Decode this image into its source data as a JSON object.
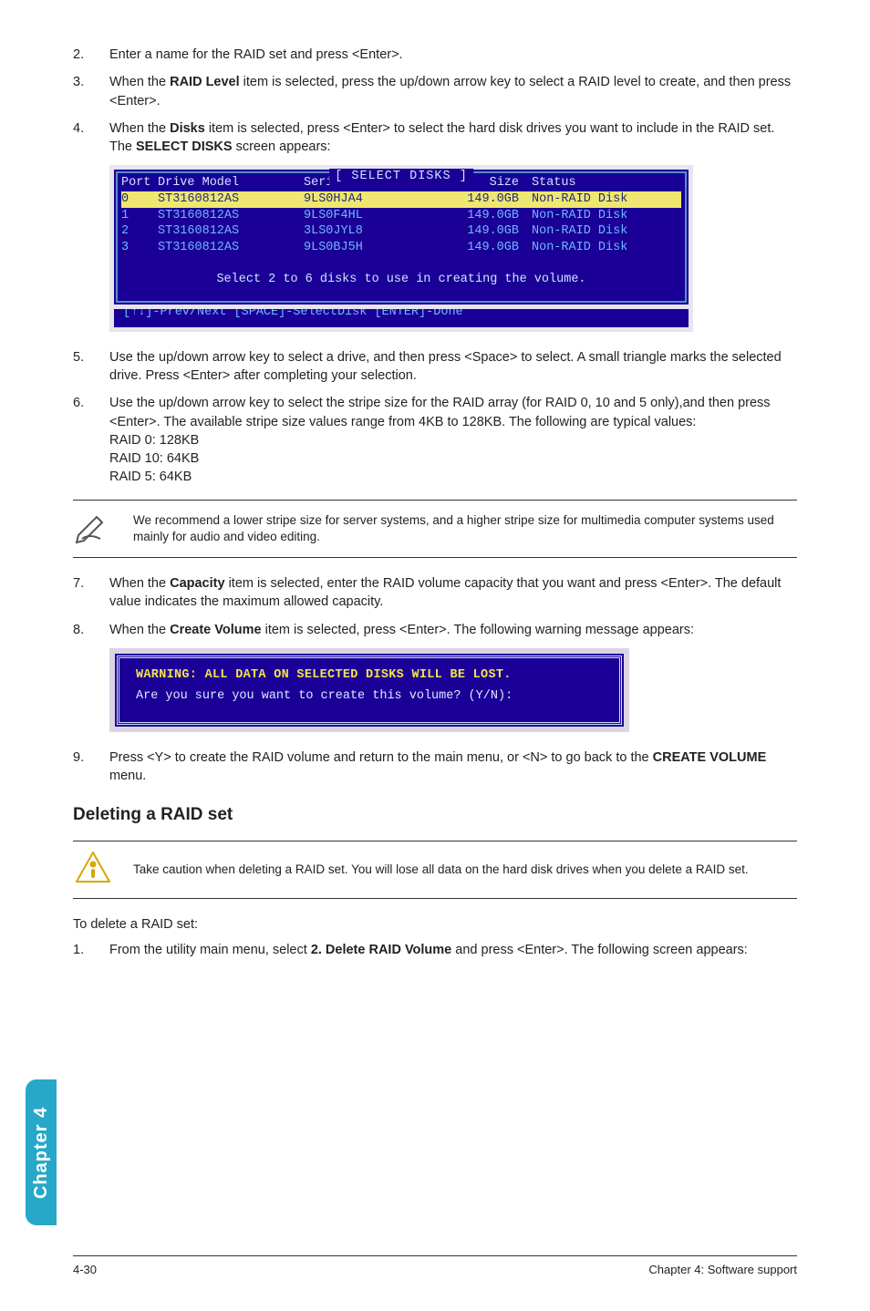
{
  "steps_a": {
    "s2": {
      "num": "2.",
      "text": "Enter a name for the RAID set and press <Enter>."
    },
    "s3": {
      "num": "3.",
      "text_a": "When the ",
      "bold": "RAID Level",
      "text_b": " item is selected, press the up/down arrow key to select a RAID level to create, and then press <Enter>."
    },
    "s4": {
      "num": "4.",
      "text_a": "When the ",
      "bold": "Disks",
      "text_b": " item is selected, press <Enter> to select the hard disk drives you want to include in the RAID set. The ",
      "bold2": "SELECT DISKS",
      "text_c": " screen appears:"
    }
  },
  "select_disks": {
    "title": "[ SELECT DISKS ]",
    "header": {
      "port": "Port",
      "drive": "Drive Model",
      "serial": "Serial #",
      "size": "Size",
      "status": "Status"
    },
    "rows": [
      {
        "port": "0",
        "drive": "ST3160812AS",
        "serial": "9LS0HJA4",
        "size": "149.0GB",
        "status": "Non-RAID Disk",
        "sel": true
      },
      {
        "port": "1",
        "drive": "ST3160812AS",
        "serial": "9LS0F4HL",
        "size": "149.0GB",
        "status": "Non-RAID Disk",
        "sel": false
      },
      {
        "port": "2",
        "drive": "ST3160812AS",
        "serial": "3LS0JYL8",
        "size": "149.0GB",
        "status": "Non-RAID Disk",
        "sel": false
      },
      {
        "port": "3",
        "drive": "ST3160812AS",
        "serial": "9LS0BJ5H",
        "size": "149.0GB",
        "status": "Non-RAID Disk",
        "sel": false
      }
    ],
    "footer": "Select 2 to 6 disks to use in creating the volume.",
    "legend": "[↑↓]-Prev/Next [SPACE]-SelectDisk [ENTER]-Done"
  },
  "steps_b": {
    "s5": {
      "num": "5.",
      "text": "Use the up/down arrow key to select a drive, and then press <Space> to select. A small triangle marks the selected drive. Press <Enter> after completing your selection."
    },
    "s6": {
      "num": "6.",
      "text": "Use the up/down arrow key to select the stripe size for the RAID array (for RAID 0, 10 and 5 only),and  then press <Enter>. The available stripe size values range from 4KB to 128KB. The following are typical values:",
      "l1": "RAID 0: 128KB",
      "l2": "RAID 10: 64KB",
      "l3": "RAID 5: 64KB"
    }
  },
  "note1": "We recommend a lower stripe size for server systems, and a higher stripe size for multimedia computer systems used mainly for audio and video editing.",
  "steps_c": {
    "s7": {
      "num": "7.",
      "text_a": "When the ",
      "bold": "Capacity",
      "text_b": " item is selected, enter the RAID volume capacity that you want and press <Enter>. The default value indicates the maximum allowed capacity."
    },
    "s8": {
      "num": "8.",
      "text_a": "When the ",
      "bold": "Create Volume",
      "text_b": " item is selected, press <Enter>. The following warning message appears:"
    }
  },
  "warn": {
    "line1": "WARNING: ALL DATA ON SELECTED DISKS WILL BE LOST.",
    "line2": "Are you sure you want to create this volume? (Y/N):"
  },
  "steps_d": {
    "s9": {
      "num": "9.",
      "text_a": "Press <Y> to create the RAID volume and return to the main menu, or <N> to go back to the ",
      "bold": "CREATE VOLUME",
      "text_b": " menu."
    }
  },
  "delete": {
    "heading": "Deleting a RAID set",
    "caution": "Take caution when deleting a RAID set. You will lose all data on the hard disk drives when you delete a RAID set.",
    "lead": "To delete a RAID set:",
    "s1": {
      "num": "1.",
      "text_a": "From the utility main menu, select ",
      "bold": "2. Delete RAID Volume",
      "text_b": " and press <Enter>. The following screen appears:"
    }
  },
  "sidetab": "Chapter 4",
  "footer": {
    "left": "4-30",
    "right": "Chapter 4: Software support"
  }
}
